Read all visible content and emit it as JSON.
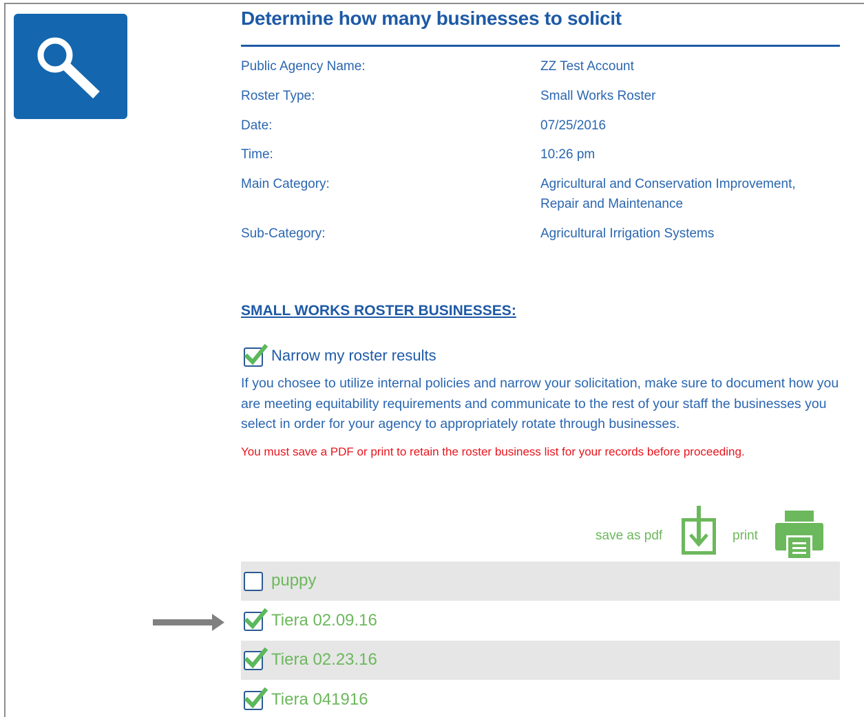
{
  "page": {
    "title": "Determine how many businesses to solicit"
  },
  "info": [
    {
      "label": "Public Agency Name:",
      "value": "ZZ Test Account"
    },
    {
      "label": "Roster Type:",
      "value": "Small Works Roster"
    },
    {
      "label": "Date:",
      "value": "07/25/2016"
    },
    {
      "label": "Time:",
      "value": "10:26 pm"
    },
    {
      "label": "Main Category:",
      "value": "Agricultural and Conservation Improvement, Repair and Maintenance"
    },
    {
      "label": "Sub-Category:",
      "value": "Agricultural Irrigation Systems"
    }
  ],
  "roster": {
    "heading": "SMALL WORKS ROSTER BUSINESSES:",
    "narrow_label": "Narrow my roster results",
    "narrow_checked": true,
    "explanation": "If you chosee to utilize internal policies and narrow your solicitation, make sure to document how you are meeting equitability requirements and communicate to the rest of your staff the businesses you select in order for your agency to appropriately rotate through businesses.",
    "warning": "You must save a PDF or print to retain the roster business list for your records before proceeding."
  },
  "actions": {
    "save_pdf_label": "save as pdf",
    "save_pdf_icon": "download-icon",
    "print_label": "print",
    "print_icon": "printer-icon"
  },
  "businesses": [
    {
      "name": "puppy",
      "checked": false
    },
    {
      "name": "Tiera 02.09.16",
      "checked": true
    },
    {
      "name": "Tiera 02.23.16",
      "checked": true
    },
    {
      "name": "Tiera 041916",
      "checked": true
    }
  ],
  "colors": {
    "primary_blue": "#1e5aa6",
    "tile_blue": "#1466ae",
    "accent_green": "#6cb85c",
    "warning_red": "#e8141c",
    "row_shade": "#e6e6e6"
  }
}
